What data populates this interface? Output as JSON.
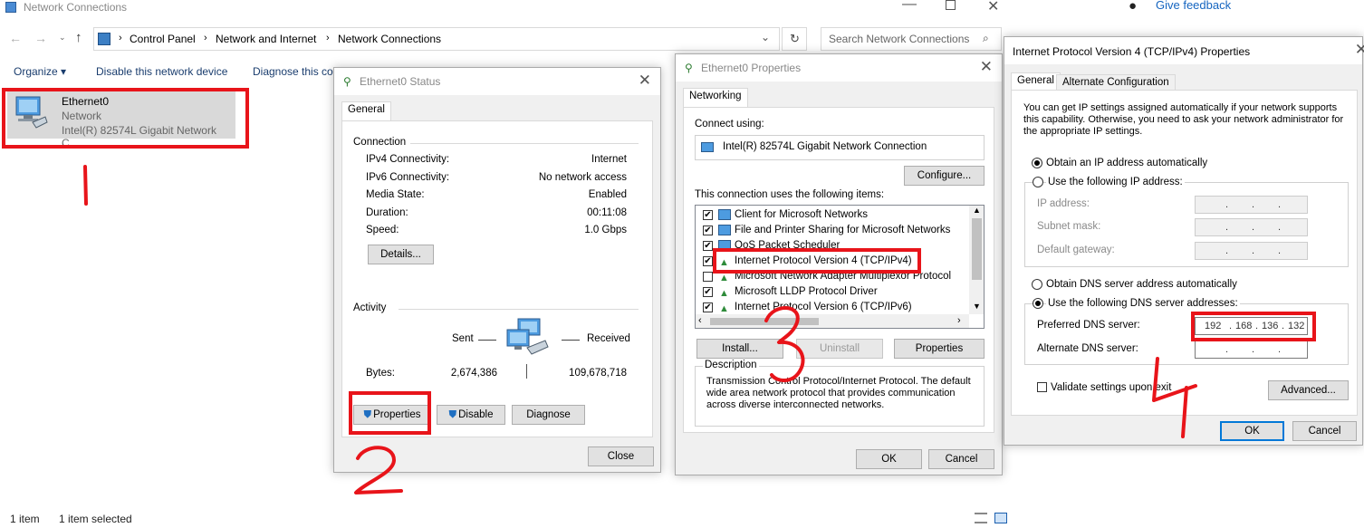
{
  "explorer": {
    "title": "Network Connections",
    "breadcrumb": [
      "Control Panel",
      "Network and Internet",
      "Network Connections"
    ],
    "search_placeholder": "Search Network Connections",
    "feedback": "Give feedback",
    "toolbar": {
      "organize": "Organize",
      "disable": "Disable this network device",
      "diagnose": "Diagnose this co"
    },
    "item": {
      "name": "Ethernet0",
      "type": "Network",
      "adapter": "Intel(R) 82574L Gigabit Network C..."
    },
    "status": {
      "count": "1 item",
      "selected": "1 item selected"
    }
  },
  "status_dialog": {
    "title": "Ethernet0 Status",
    "tab": "General",
    "connection_header": "Connection",
    "rows": [
      {
        "label": "IPv4 Connectivity:",
        "value": "Internet"
      },
      {
        "label": "IPv6 Connectivity:",
        "value": "No network access"
      },
      {
        "label": "Media State:",
        "value": "Enabled"
      },
      {
        "label": "Duration:",
        "value": "00:11:08"
      },
      {
        "label": "Speed:",
        "value": "1.0 Gbps"
      }
    ],
    "details_btn": "Details...",
    "activity_header": "Activity",
    "sent": "Sent",
    "received": "Received",
    "bytes_label": "Bytes:",
    "bytes_sent": "2,674,386",
    "bytes_received": "109,678,718",
    "properties_btn": "Properties",
    "disable_btn": "Disable",
    "diagnose_btn": "Diagnose",
    "close_btn": "Close"
  },
  "props_dialog": {
    "title": "Ethernet0 Properties",
    "tab": "Networking",
    "connect_using_label": "Connect using:",
    "adapter": "Intel(R) 82574L Gigabit Network Connection",
    "configure_btn": "Configure...",
    "items_label": "This connection uses the following items:",
    "items": [
      {
        "label": "Client for Microsoft Networks",
        "checked": "✔"
      },
      {
        "label": "File and Printer Sharing for Microsoft Networks",
        "checked": "✔"
      },
      {
        "label": "QoS Packet Scheduler",
        "checked": "✔"
      },
      {
        "label": "Internet Protocol Version 4 (TCP/IPv4)",
        "checked": "✔"
      },
      {
        "label": "Microsoft Network Adapter Multiplexor Protocol",
        "checked": ""
      },
      {
        "label": "Microsoft LLDP Protocol Driver",
        "checked": "✔"
      },
      {
        "label": "Internet Protocol Version 6 (TCP/IPv6)",
        "checked": "✔"
      }
    ],
    "install_btn": "Install...",
    "uninstall_btn": "Uninstall",
    "properties_btn": "Properties",
    "description_label": "Description",
    "description": "Transmission Control Protocol/Internet Protocol. The default wide area network protocol that provides communication across diverse interconnected networks.",
    "ok_btn": "OK",
    "cancel_btn": "Cancel"
  },
  "ipv4_dialog": {
    "title": "Internet Protocol Version 4 (TCP/IPv4) Properties",
    "tabs": [
      "General",
      "Alternate Configuration"
    ],
    "intro": "You can get IP settings assigned automatically if your network supports this capability. Otherwise, you need to ask your network administrator for the appropriate IP settings.",
    "obtain_ip": "Obtain an IP address automatically",
    "use_ip": "Use the following IP address:",
    "ip_label": "IP address:",
    "mask_label": "Subnet mask:",
    "gateway_label": "Default gateway:",
    "obtain_dns": "Obtain DNS server address automatically",
    "use_dns": "Use the following DNS server addresses:",
    "preferred_label": "Preferred DNS server:",
    "preferred_value": [
      "192",
      "168",
      "136",
      "132"
    ],
    "alternate_label": "Alternate DNS server:",
    "validate": "Validate settings upon exit",
    "advanced_btn": "Advanced...",
    "ok_btn": "OK",
    "cancel_btn": "Cancel"
  },
  "annotations": [
    "1",
    "2",
    "3",
    "4"
  ],
  "colors": {
    "annotation_red": "#e8141a",
    "accent": "#0078d7"
  }
}
